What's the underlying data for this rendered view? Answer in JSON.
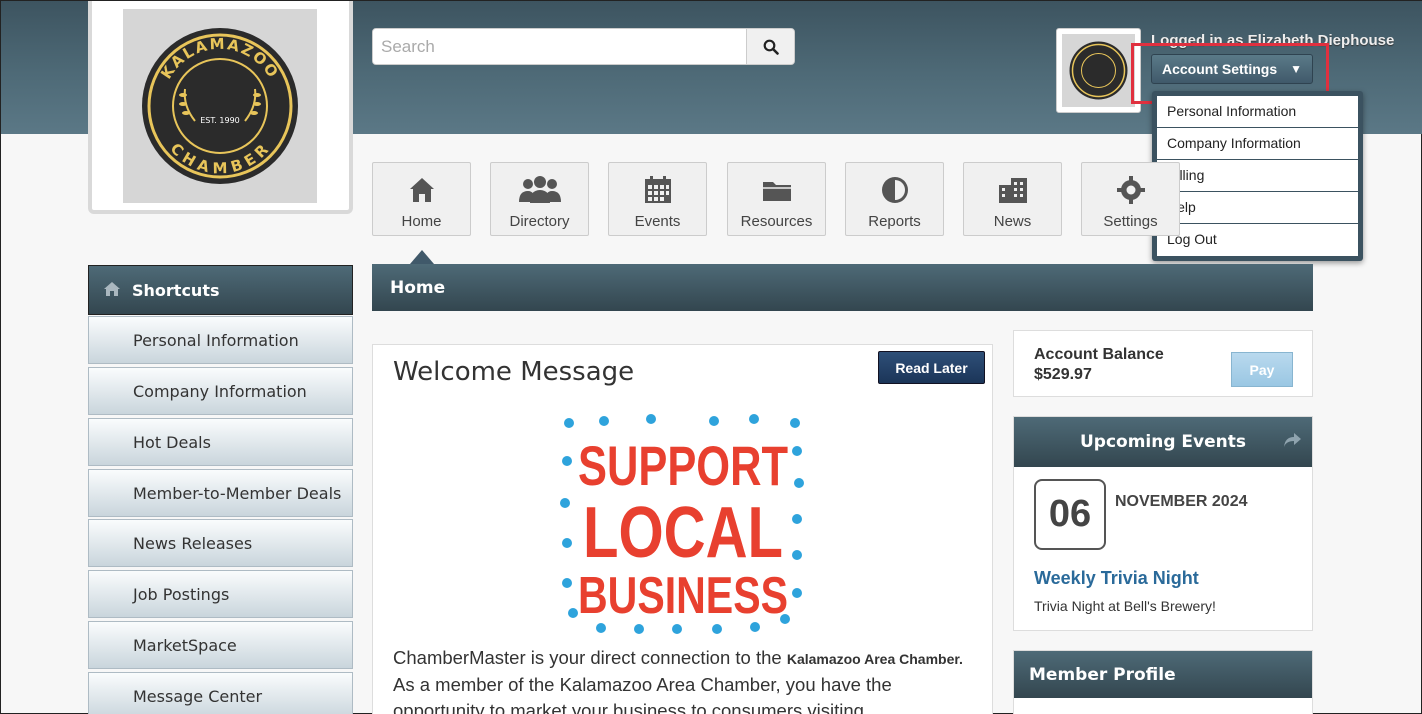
{
  "header": {
    "search_placeholder": "Search",
    "logged_in_text": "Logged in as Elizabeth Diephouse",
    "account_button": "Account Settings",
    "account_menu": [
      "Personal Information",
      "Company Information",
      "Billing",
      "Help",
      "Log Out"
    ]
  },
  "logo": {
    "top_text": "KALAMAZOO",
    "est": "EST. 1990",
    "bottom_text": "CHAMBER"
  },
  "nav_tiles": [
    {
      "label": "Home",
      "icon": "home-icon"
    },
    {
      "label": "Directory",
      "icon": "people-icon"
    },
    {
      "label": "Events",
      "icon": "calendar-icon"
    },
    {
      "label": "Resources",
      "icon": "folder-icon"
    },
    {
      "label": "Reports",
      "icon": "pie-chart-icon"
    },
    {
      "label": "News",
      "icon": "building-icon"
    },
    {
      "label": "Settings",
      "icon": "gear-icon"
    }
  ],
  "sidebar": {
    "title": "Shortcuts",
    "items": [
      "Personal Information",
      "Company Information",
      "Hot Deals",
      "Member-to-Member Deals",
      "News Releases",
      "Job Postings",
      "MarketSpace",
      "Message Center"
    ]
  },
  "main": {
    "title": "Home",
    "welcome_title": "Welcome Message",
    "read_later": "Read Later",
    "image_text": [
      "SUPPORT",
      "LOCAL",
      "BUSINESS"
    ],
    "text_part1": "ChamberMaster is your direct connection to the ",
    "text_bold": "Kalamazoo Area Chamber.",
    "text_part2": " As a member of the Kalamazoo Area Chamber, you have the opportunity to market your business to consumers visiting"
  },
  "balance": {
    "label": "Account Balance",
    "amount": "$529.97",
    "pay_label": "Pay"
  },
  "events": {
    "title": "Upcoming Events",
    "day": "06",
    "month_year": "NOVEMBER 2024",
    "event_title": "Weekly Trivia Night",
    "event_desc": "Trivia Night at Bell's Brewery!"
  },
  "member_profile": {
    "title": "Member Profile"
  },
  "colors": {
    "header_bg": "#4e6a77",
    "highlight": "#e0303f",
    "link": "#2a6a9a",
    "read_later_bg": "#1b3558",
    "logo_gold": "#e8c55a",
    "logo_dark": "#2b2b2b",
    "support_red": "#e8402f",
    "dot_blue": "#2ea3dc"
  }
}
